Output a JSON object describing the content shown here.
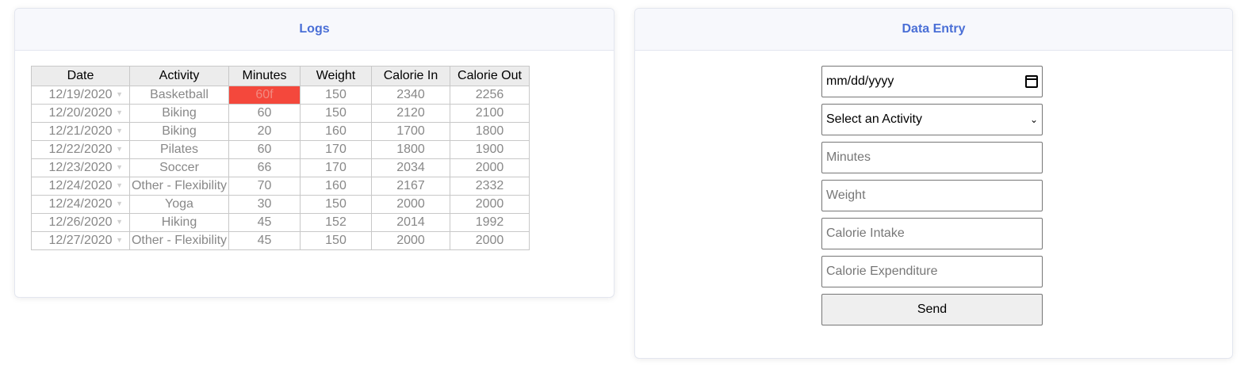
{
  "logs": {
    "title": "Logs",
    "columns": [
      "Date",
      "Activity",
      "Minutes",
      "Weight",
      "Calorie In",
      "Calorie Out"
    ],
    "rows": [
      {
        "date": "12/19/2020",
        "activity": "Basketball",
        "minutes": "60f",
        "weight": "150",
        "cal_in": "2340",
        "cal_out": "2256"
      },
      {
        "date": "12/20/2020",
        "activity": "Biking",
        "minutes": "60",
        "weight": "150",
        "cal_in": "2120",
        "cal_out": "2100"
      },
      {
        "date": "12/21/2020",
        "activity": "Biking",
        "minutes": "20",
        "weight": "160",
        "cal_in": "1700",
        "cal_out": "1800"
      },
      {
        "date": "12/22/2020",
        "activity": "Pilates",
        "minutes": "60",
        "weight": "170",
        "cal_in": "1800",
        "cal_out": "1900"
      },
      {
        "date": "12/23/2020",
        "activity": "Soccer",
        "minutes": "66",
        "weight": "170",
        "cal_in": "2034",
        "cal_out": "2000"
      },
      {
        "date": "12/24/2020",
        "activity": "Other - Flexibility",
        "minutes": "70",
        "weight": "160",
        "cal_in": "2167",
        "cal_out": "2332"
      },
      {
        "date": "12/24/2020",
        "activity": "Yoga",
        "minutes": "30",
        "weight": "150",
        "cal_in": "2000",
        "cal_out": "2000"
      },
      {
        "date": "12/26/2020",
        "activity": "Hiking",
        "minutes": "45",
        "weight": "152",
        "cal_in": "2014",
        "cal_out": "1992"
      },
      {
        "date": "12/27/2020",
        "activity": "Other - Flexibility",
        "minutes": "45",
        "weight": "150",
        "cal_in": "2000",
        "cal_out": "2000"
      }
    ],
    "error_color": "#f4483c"
  },
  "entry": {
    "title": "Data Entry",
    "date_value": "mm/dd/yyyy",
    "activity_selected": "Select an Activity",
    "minutes_placeholder": "Minutes",
    "weight_placeholder": "Weight",
    "cal_in_placeholder": "Calorie Intake",
    "cal_out_placeholder": "Calorie Expenditure",
    "send_label": "Send"
  },
  "icons": {
    "date": "calendar-icon",
    "select": "chevron-down-icon",
    "row_dropdown": "triangle-down-icon"
  },
  "accent_color": "#4a6fd6"
}
